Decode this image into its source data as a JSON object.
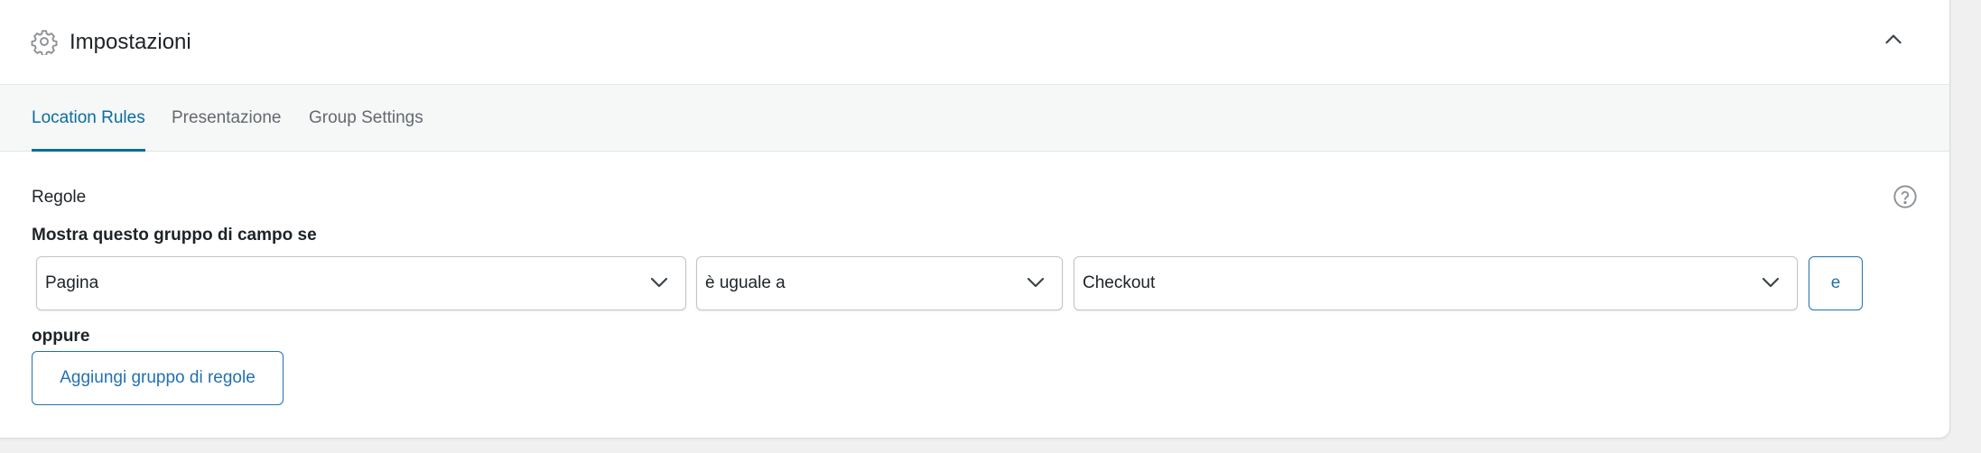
{
  "header": {
    "title": "Impostazioni",
    "icon": "gear-icon",
    "collapse_icon": "chevron-up-icon"
  },
  "tabs": [
    {
      "label": "Location Rules",
      "active": true
    },
    {
      "label": "Presentazione",
      "active": false
    },
    {
      "label": "Group Settings",
      "active": false
    }
  ],
  "rules": {
    "label": "Regole",
    "help_icon": "help-icon",
    "show_if_label": "Mostra questo gruppo di campo se",
    "rule_row": {
      "param": "Pagina",
      "operator": "è uguale a",
      "value": "Checkout",
      "and_label": "e"
    },
    "or_label": "oppure",
    "add_group_label": "Aggiungi gruppo di regole"
  },
  "colors": {
    "accent": "#2271b1",
    "active_tab": "#0a6d9c",
    "tab_bar_bg": "#f6f7f7",
    "page_bg": "#f0f0f1"
  }
}
